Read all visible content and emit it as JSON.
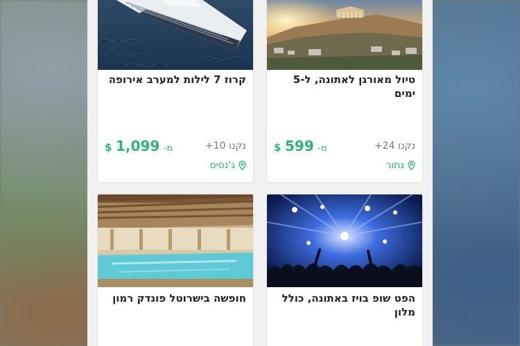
{
  "deals": [
    {
      "title": "טיול מאורגן לאתונה, ל-5 ימים",
      "bought": "נקנו 24+",
      "price_prefix": "מ-",
      "price": "599",
      "currency": "$",
      "location": "נתור",
      "image": "athens-acropolis"
    },
    {
      "title": "קרוז 7 לילות למערב אירופה",
      "bought": "נקנו 10+",
      "price_prefix": "מ-",
      "price": "1,099",
      "currency": "$",
      "location": "ג'נסיס",
      "image": "cruise-ship"
    },
    {
      "title": "הפט שופ בויז באתונה, כולל מלון",
      "image": "concert-stage"
    },
    {
      "title": "חופשה בישרוטל פונדק רמון",
      "image": "indoor-pool"
    }
  ],
  "colors": {
    "accent": "#2bb673",
    "text": "#222222",
    "muted": "#777777"
  },
  "icons": {
    "location": "map-pin-icon"
  }
}
